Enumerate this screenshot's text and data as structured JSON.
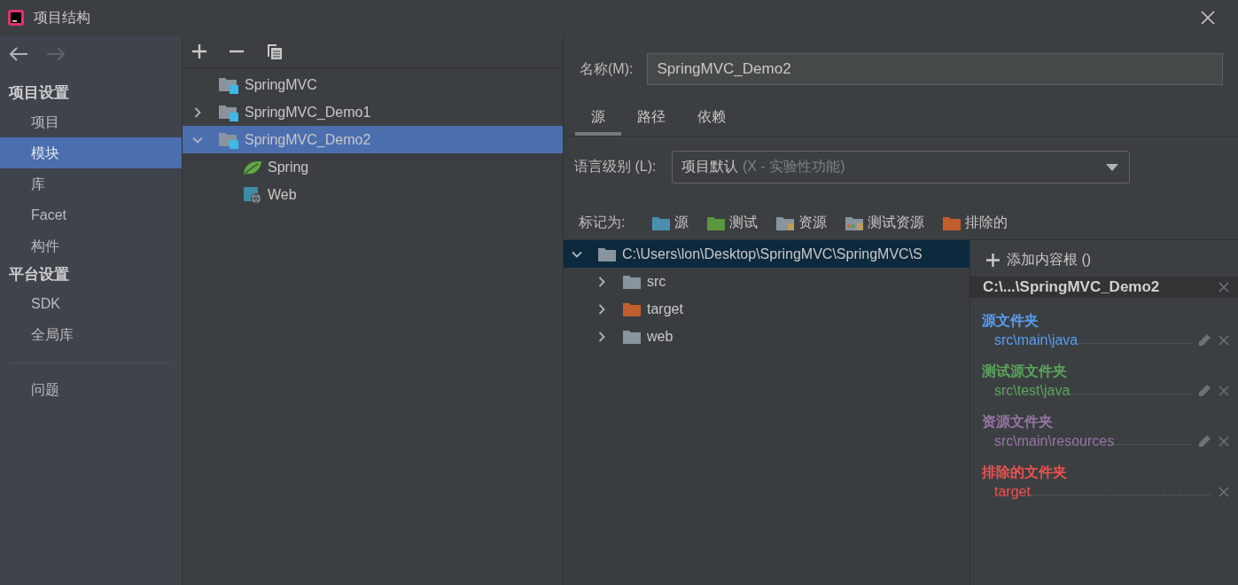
{
  "window": {
    "title": "项目结构"
  },
  "nav_buttons": [
    {
      "kind": "back",
      "disabled": false
    },
    {
      "kind": "forward",
      "disabled": true
    }
  ],
  "sidebar": {
    "sections": [
      {
        "title": "项目设置",
        "items": [
          {
            "label": "项目",
            "selected": false
          },
          {
            "label": "模块",
            "selected": true
          },
          {
            "label": "库",
            "selected": false
          },
          {
            "label": "Facet",
            "selected": false
          },
          {
            "label": "构件",
            "selected": false
          }
        ]
      },
      {
        "title": "平台设置",
        "items": [
          {
            "label": "SDK",
            "selected": false
          },
          {
            "label": "全局库",
            "selected": false
          }
        ]
      }
    ],
    "bottom_items": [
      {
        "label": "问题",
        "selected": false
      }
    ]
  },
  "modules": [
    {
      "label": "SpringMVC",
      "selected": false
    },
    {
      "label": "SpringMVC_Demo1",
      "expanded": false,
      "selected": false
    },
    {
      "label": "SpringMVC_Demo2",
      "expanded": true,
      "selected": true,
      "children": [
        {
          "label": "Spring",
          "kind": "spring"
        },
        {
          "label": "Web",
          "kind": "web"
        }
      ]
    }
  ],
  "name_field": {
    "label": "名称(M):",
    "value": "SpringMVC_Demo2"
  },
  "tabs": [
    {
      "label": "源",
      "selected": true
    },
    {
      "label": "路径",
      "selected": false
    },
    {
      "label": "依赖",
      "selected": false
    }
  ],
  "language_level": {
    "label": "语言级别 (L):",
    "value": "项目默认",
    "hint": "(X - 实验性功能)"
  },
  "mark_as": {
    "label": "标记为:",
    "buttons": [
      {
        "label": "源",
        "kind": "source"
      },
      {
        "label": "测试",
        "kind": "test"
      },
      {
        "label": "资源",
        "kind": "resource"
      },
      {
        "label": "测试资源",
        "kind": "test_resource"
      },
      {
        "label": "排除的",
        "kind": "excluded"
      }
    ]
  },
  "content_tree": {
    "label": "C:\\Users\\lon\\Desktop\\SpringMVC\\SpringMVC\\S",
    "expanded": true,
    "selected": true,
    "children": [
      {
        "label": "src",
        "kind": "plain",
        "expanded": false
      },
      {
        "label": "target",
        "kind": "excluded",
        "expanded": false
      },
      {
        "label": "web",
        "kind": "plain",
        "expanded": false
      }
    ]
  },
  "content_roots": {
    "add_label": "添加内容根 ()",
    "root_title": "C:\\...\\SpringMVC_Demo2",
    "groups": [
      {
        "title": "源文件夹",
        "color": "#589df6",
        "folders": [
          {
            "path": "src\\main\\java",
            "editable": true
          }
        ]
      },
      {
        "title": "测试源文件夹",
        "color": "#5ba55e",
        "folders": [
          {
            "path": "src\\test\\java",
            "editable": true
          }
        ]
      },
      {
        "title": "资源文件夹",
        "color": "#9876aa",
        "folders": [
          {
            "path": "src\\main\\resources",
            "editable": true
          }
        ]
      },
      {
        "title": "排除的文件夹",
        "color": "#f05050",
        "folders": [
          {
            "path": "target",
            "editable": false
          }
        ]
      }
    ]
  }
}
